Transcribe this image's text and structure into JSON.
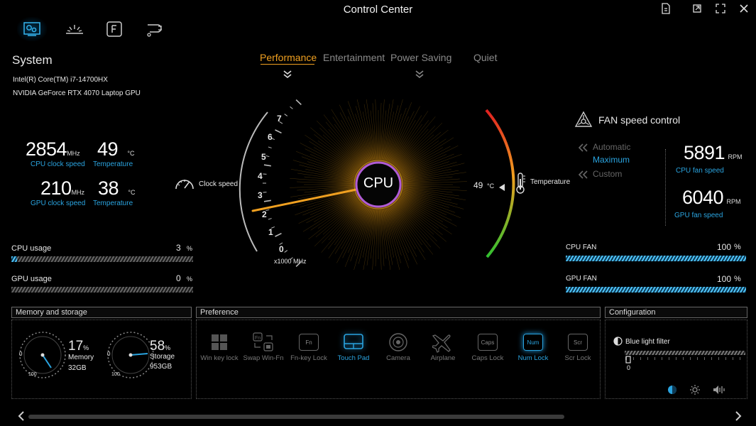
{
  "app": {
    "title": "Control Center"
  },
  "nav": {
    "items": [
      "system-icon",
      "display-icon",
      "keyboard-icon",
      "network-icon"
    ]
  },
  "system": {
    "heading": "System",
    "cpu_name": "Intel(R) Core(TM) i7-14700HX",
    "gpu_name": "NVIDIA GeForce RTX 4070 Laptop GPU",
    "cpu_clock": {
      "value": "2854",
      "unit": "MHz",
      "label": "CPU clock speed"
    },
    "cpu_temp": {
      "value": "49",
      "unit": "°C",
      "label": "Temperature"
    },
    "gpu_clock": {
      "value": "210",
      "unit": "MHz",
      "label": "GPU clock speed"
    },
    "gpu_temp": {
      "value": "38",
      "unit": "°C",
      "label": "Temperature"
    },
    "cpu_usage": {
      "label": "CPU usage",
      "value": "3",
      "unit": "%",
      "fraction": 0.03
    },
    "gpu_usage": {
      "label": "GPU usage",
      "value": "0",
      "unit": "%",
      "fraction": 0.0
    }
  },
  "modes": {
    "tabs": [
      {
        "label": "Performance",
        "active": true
      },
      {
        "label": "Entertainment",
        "active": false
      },
      {
        "label": "Power Saving",
        "active": false
      },
      {
        "label": "Quiet",
        "active": false
      }
    ]
  },
  "gauge": {
    "center_label": "CPU",
    "clock_label": "Clock speed",
    "scale_ticks": [
      "0",
      "1",
      "2",
      "3",
      "4",
      "5",
      "6",
      "7"
    ],
    "scale_unit": "x1000 MHz",
    "needle_value": 2.854,
    "temp_value": "49",
    "temp_unit": "°C",
    "temp_label": "Temperature"
  },
  "fan": {
    "heading": "FAN speed control",
    "modes": [
      "Automatic",
      "Maximum",
      "Custom"
    ],
    "selected_mode": "Maximum",
    "cpu_rpm": {
      "value": "5891",
      "unit": "RPM",
      "label": "CPU fan speed"
    },
    "gpu_rpm": {
      "value": "6040",
      "unit": "RPM",
      "label": "GPU fan speed"
    },
    "cpu_fan": {
      "label": "CPU FAN",
      "value": "100",
      "unit": "%",
      "fraction": 1.0
    },
    "gpu_fan": {
      "label": "GPU FAN",
      "value": "100",
      "unit": "%",
      "fraction": 1.0
    }
  },
  "memory": {
    "title": "Memory and storage",
    "memory": {
      "percent": "17",
      "unit": "%",
      "label": "Memory",
      "size": "32GB",
      "fraction": 0.17
    },
    "storage": {
      "percent": "58",
      "unit": "%",
      "label": "Storage",
      "size": "953GB",
      "fraction": 0.58
    },
    "dial_min": "0",
    "dial_max": "100"
  },
  "preference": {
    "title": "Preference",
    "items": [
      {
        "label": "Win key lock",
        "key": "",
        "on": false
      },
      {
        "label": "Swap Win-Fn",
        "key": "",
        "on": false
      },
      {
        "label": "Fn-key Lock",
        "key": "Fn",
        "on": false
      },
      {
        "label": "Touch Pad",
        "key": "",
        "on": true
      },
      {
        "label": "Camera",
        "key": "",
        "on": false
      },
      {
        "label": "Airplane",
        "key": "",
        "on": false
      },
      {
        "label": "Caps Lock",
        "key": "Caps",
        "on": false
      },
      {
        "label": "Num Lock",
        "key": "Num",
        "on": true
      },
      {
        "label": "Scr Lock",
        "key": "Scr",
        "on": false
      }
    ]
  },
  "configuration": {
    "title": "Configuration",
    "blue_light": {
      "label": "Blue light filter",
      "value": "0"
    }
  },
  "colors": {
    "accent": "#2aa4e0",
    "needle": "#f0a020",
    "glow": "#f5b733",
    "ring": "#b05cd6"
  }
}
